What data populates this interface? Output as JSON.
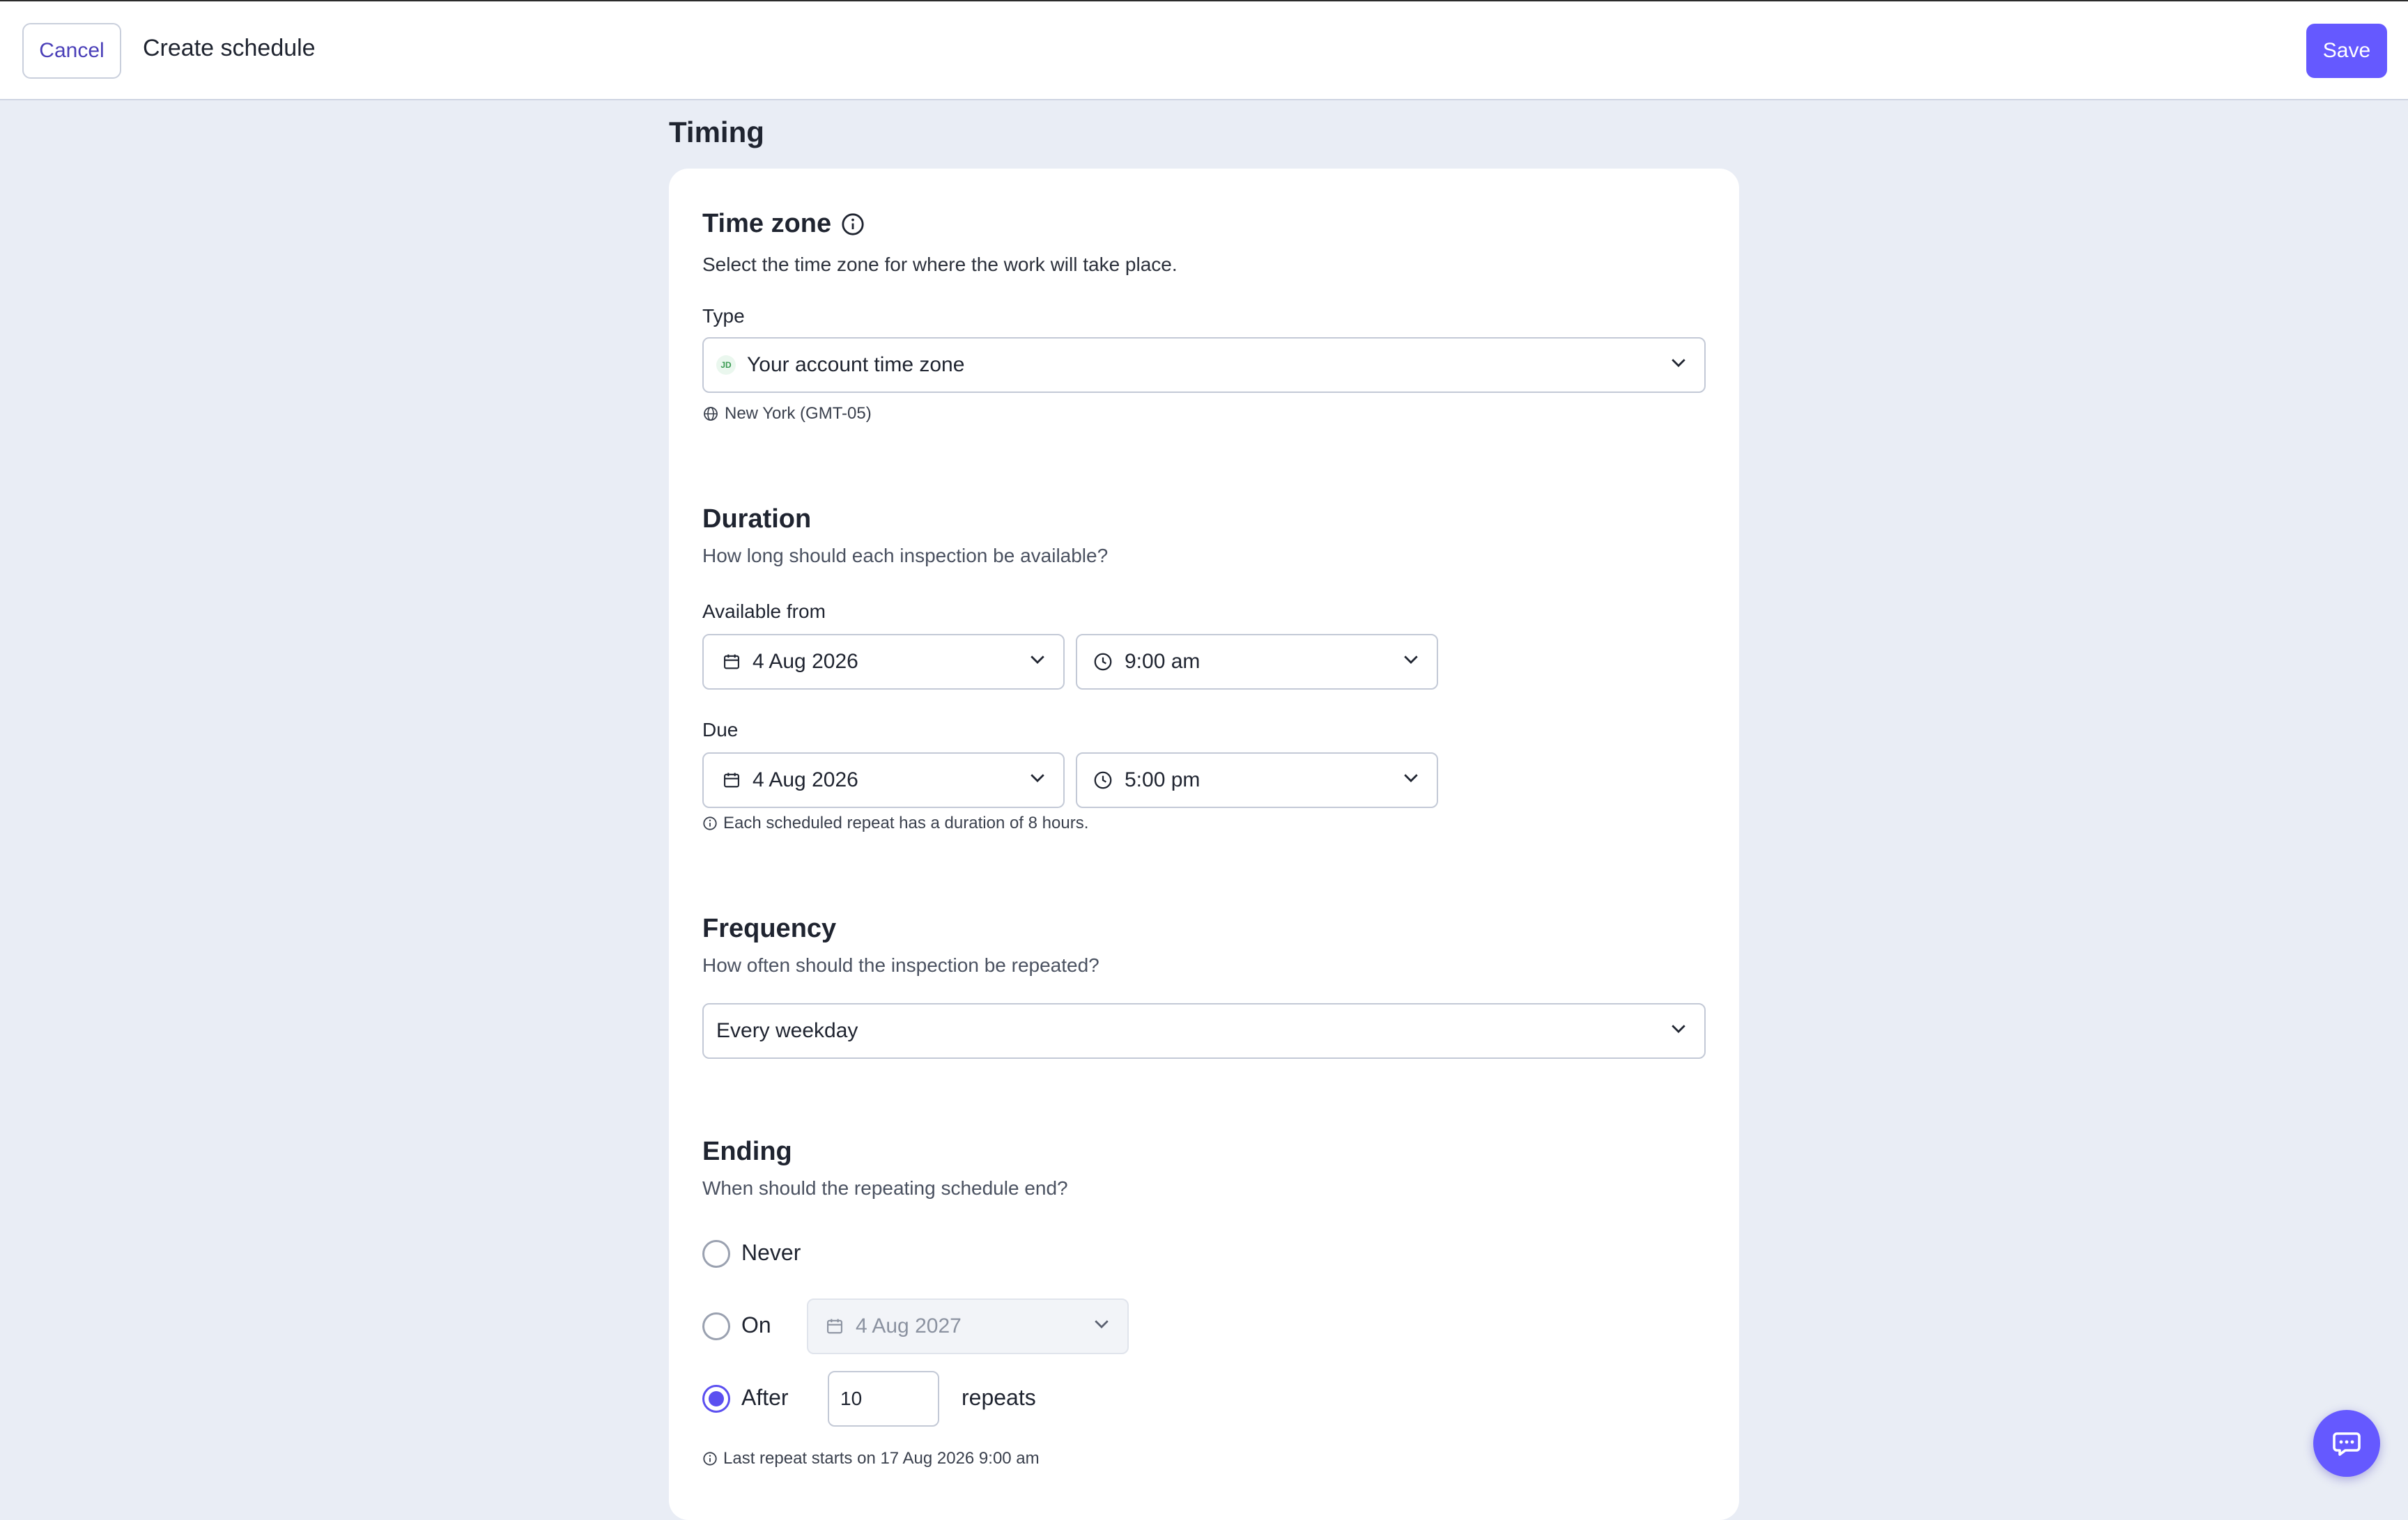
{
  "header": {
    "cancel_label": "Cancel",
    "title": "Create schedule",
    "save_label": "Save"
  },
  "section_title": "Timing",
  "timezone": {
    "title": "Time zone",
    "description": "Select the time zone for where the work will take place.",
    "type_label": "Type",
    "type_value": "Your account time zone",
    "avatar_initials": "JD",
    "location": "New York (GMT-05)"
  },
  "duration": {
    "title": "Duration",
    "description": "How long should each inspection be available?",
    "available_from_label": "Available from",
    "available_from_date": "4 Aug 2026",
    "available_from_time": "9:00 am",
    "due_label": "Due",
    "due_date": "4 Aug 2026",
    "due_time": "5:00 pm",
    "help": "Each scheduled repeat has a duration of 8 hours."
  },
  "frequency": {
    "title": "Frequency",
    "description": "How often should the inspection be repeated?",
    "value": "Every weekday"
  },
  "ending": {
    "title": "Ending",
    "description": "When should the repeating schedule end?",
    "never_label": "Never",
    "on_label": "On",
    "on_date": "4 Aug 2027",
    "after_label": "After",
    "after_count": "10",
    "repeats_label": "repeats",
    "selected": "after",
    "help": "Last repeat starts on 17 Aug 2026 9:00 am"
  },
  "colors": {
    "accent": "#6559ff",
    "background": "#e9edf5"
  }
}
